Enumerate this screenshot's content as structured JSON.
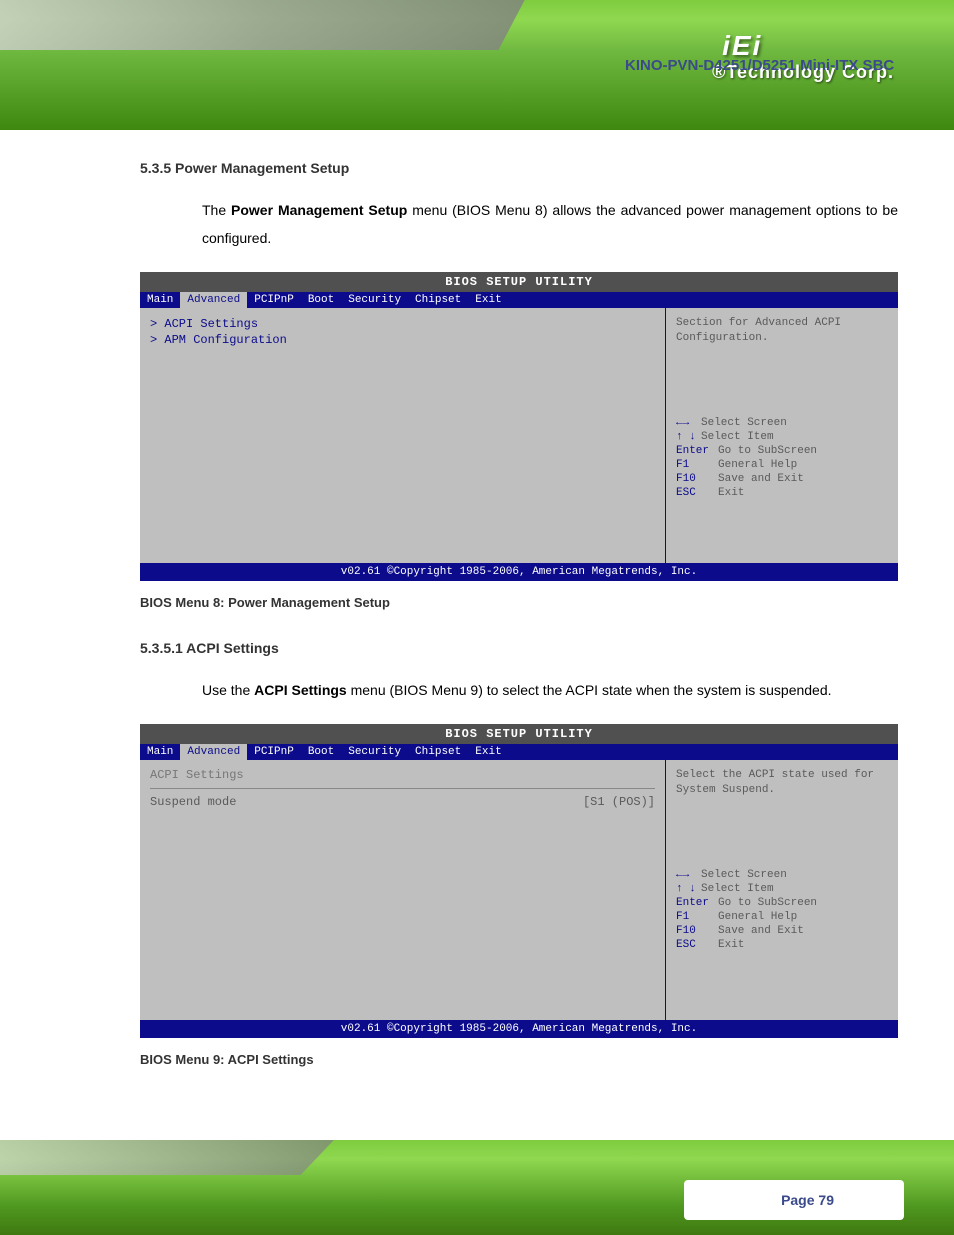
{
  "header": {
    "logo": "iEi",
    "tagline": "®Technology Corp.",
    "product": "KINO-PVN-D4251/D5251 Mini-ITX SBC"
  },
  "section1": {
    "heading": "5.3.5 Power Management Setup",
    "intro_pre": "The ",
    "intro_bold": "Power Management Setup",
    "intro_post": " menu (BIOS Menu 8) allows the advanced power management options to be configured."
  },
  "bios1": {
    "title": "BIOS SETUP UTILITY",
    "tabs": [
      "Main",
      "Advanced",
      "PCIPnP",
      "Boot",
      "Security",
      "Chipset",
      "Exit"
    ],
    "items": [
      "> ACPI Settings",
      "> APM Configuration"
    ],
    "help": "Section for Advanced ACPI Configuration.",
    "keys": [
      {
        "k": "←→",
        "d": "Select Screen"
      },
      {
        "k": "↑ ↓",
        "d": "Select Item"
      },
      {
        "k": "Enter",
        "d": "Go to SubScreen"
      },
      {
        "k": "F1",
        "d": "General Help"
      },
      {
        "k": "F10",
        "d": "Save and Exit"
      },
      {
        "k": "ESC",
        "d": "Exit"
      }
    ],
    "footer": "v02.61 ©Copyright 1985-2006, American Megatrends, Inc.",
    "caption": "BIOS Menu 8: Power Management Setup"
  },
  "section2": {
    "heading": "5.3.5.1 ACPI Settings",
    "intro_pre": "Use the ",
    "intro_bold": "ACPI Settings",
    "intro_post": " menu (BIOS Menu 9) to select the ACPI state when the system is suspended."
  },
  "bios2": {
    "title": "BIOS SETUP UTILITY",
    "tabs": [
      "Main",
      "Advanced",
      "PCIPnP",
      "Boot",
      "Security",
      "Chipset",
      "Exit"
    ],
    "section_label": "ACPI Settings",
    "setting_name": "Suspend mode",
    "setting_val": "[S1 (POS)]",
    "help": "Select the ACPI state used for System Suspend.",
    "keys": [
      {
        "k": "←→",
        "d": "Select Screen"
      },
      {
        "k": "↑ ↓",
        "d": "Select Item"
      },
      {
        "k": "Enter",
        "d": "Go to SubScreen"
      },
      {
        "k": "F1",
        "d": "General Help"
      },
      {
        "k": "F10",
        "d": "Save and Exit"
      },
      {
        "k": "ESC",
        "d": "Exit"
      }
    ],
    "footer": "v02.61 ©Copyright 1985-2006, American Megatrends, Inc.",
    "caption": "BIOS Menu 9: ACPI Settings"
  },
  "footer": {
    "page": "Page 79"
  }
}
